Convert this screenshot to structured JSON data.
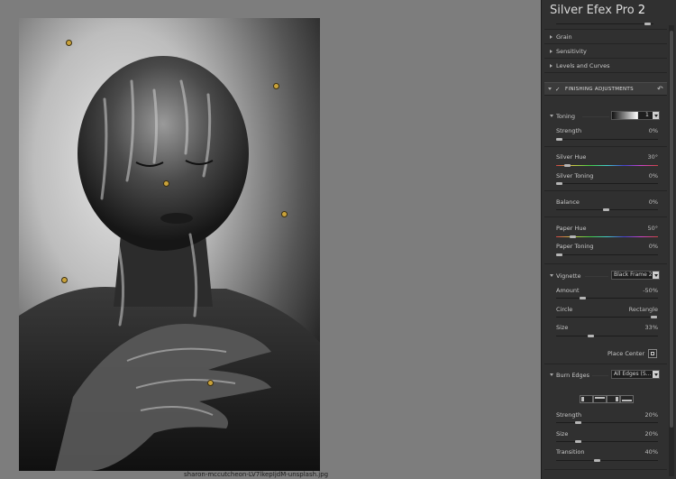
{
  "app": {
    "name": "Silver Efex Pro",
    "version": "2"
  },
  "image": {
    "filename": "sharon-mccutcheon-LV7lkepIjdM-unsplash.jpg"
  },
  "sections": {
    "grain": "Grain",
    "sensitivity": "Sensitivity",
    "levels": "Levels and Curves",
    "finishing": "FINISHING ADJUSTMENTS",
    "finishing_check": "✓"
  },
  "toning": {
    "label": "Toning",
    "preset": "1",
    "strength": {
      "label": "Strength",
      "value": "0%",
      "level": 0
    },
    "silver_hue": {
      "label": "Silver Hue",
      "value": "30°",
      "level": 0.08
    },
    "silver_toning": {
      "label": "Silver Toning",
      "value": "0%",
      "level": 0
    },
    "balance": {
      "label": "Balance",
      "value": "0%",
      "level": 0.5
    },
    "paper_hue": {
      "label": "Paper Hue",
      "value": "50°",
      "level": 0.14
    },
    "paper_toning": {
      "label": "Paper Toning",
      "value": "0%",
      "level": 0
    }
  },
  "vignette": {
    "label": "Vignette",
    "preset": "Black Frame 2",
    "amount": {
      "label": "Amount",
      "value": "-50%",
      "level": 0.25
    },
    "circle": {
      "label": "Circle",
      "alt": "Rectangle",
      "level": 1
    },
    "size": {
      "label": "Size",
      "value": "33%",
      "level": 0.33
    },
    "place_center": "Place Center"
  },
  "burn_edges": {
    "label": "Burn Edges",
    "preset": "All Edges (S...",
    "strength": {
      "label": "Strength",
      "value": "20%",
      "level": 0.2
    },
    "size": {
      "label": "Size",
      "value": "20%",
      "level": 0.2
    },
    "transition": {
      "label": "Transition",
      "value": "40%",
      "level": 0.4
    }
  },
  "colors": {
    "panel_bg": "#303030",
    "canvas_bg": "#7d7d7d",
    "control_point": "#c9a23a"
  },
  "icons": {
    "collapsed": "triangle-right-icon",
    "expanded": "triangle-down-icon",
    "reset": "reset-arrow-icon",
    "place_center": "crosshair-icon"
  }
}
